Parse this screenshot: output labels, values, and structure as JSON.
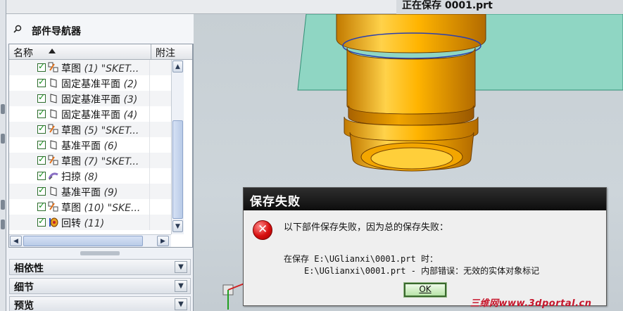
{
  "status": {
    "saving_text": "正在保存 0001.prt"
  },
  "navigator": {
    "title": "部件导航器",
    "columns": {
      "name": "名称",
      "note": "附注"
    },
    "rows": [
      {
        "label": "草图 ",
        "num": "(1) \"SKET...",
        "icon": "sketch-icon"
      },
      {
        "label": "固定基准平面 ",
        "num": "(2)",
        "icon": "datum-plane-icon"
      },
      {
        "label": "固定基准平面 ",
        "num": "(3)",
        "icon": "datum-plane-icon"
      },
      {
        "label": "固定基准平面 ",
        "num": "(4)",
        "icon": "datum-plane-icon"
      },
      {
        "label": "草图 ",
        "num": "(5) \"SKET...",
        "icon": "sketch-icon"
      },
      {
        "label": "基准平面 ",
        "num": "(6)",
        "icon": "datum-plane-icon"
      },
      {
        "label": "草图 ",
        "num": "(7) \"SKET...",
        "icon": "sketch-icon"
      },
      {
        "label": "扫掠 ",
        "num": "(8)",
        "icon": "sweep-icon"
      },
      {
        "label": "基准平面 ",
        "num": "(9)",
        "icon": "datum-plane-icon"
      },
      {
        "label": "草图 ",
        "num": "(10) \"SKE...",
        "icon": "sketch-icon"
      },
      {
        "label": "回转 ",
        "num": "(11)",
        "icon": "revolve-icon"
      }
    ],
    "sections": [
      {
        "label": "相依性"
      },
      {
        "label": "细节"
      },
      {
        "label": "预览"
      }
    ]
  },
  "dialog": {
    "title": "保存失败",
    "message": "以下部件保存失败，因为总的保存失败：",
    "detail_line1": "在保存 E:\\UGlianxi\\0001.prt 时：",
    "detail_line2": "E:\\UGlianxi\\0001.prt -  内部错误：无效的实体对象标记",
    "ok_label": "OK"
  },
  "watermark": "三维网www.3dportal.cn",
  "colors": {
    "part_gold": "#f2a600",
    "dialog_title_bg": "#1a1a1a",
    "ok_green": "#b8e4a8"
  }
}
